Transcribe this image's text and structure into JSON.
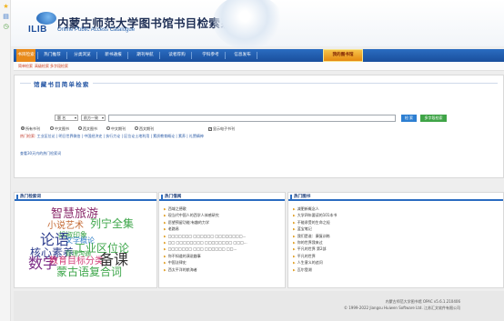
{
  "leftbar": {
    "icons": [
      "star-icon",
      "bookmark-icon",
      "history-icon"
    ],
    "colors": {
      "star": "#f1b41d",
      "bookmark": "#3c78c8",
      "history": "#4a9a3a"
    }
  },
  "header": {
    "logo_text": "ILIB",
    "title": "内蒙古师范大学图书馆书目检索系统",
    "subtitle": "Online Public Access Catalogue"
  },
  "nav": {
    "tabs": [
      {
        "label": "书目检索",
        "active": true
      },
      {
        "label": "热门推荐"
      },
      {
        "label": "分类浏览"
      },
      {
        "label": "新书通报"
      },
      {
        "label": "期刊导航"
      },
      {
        "label": "读者荐购"
      },
      {
        "label": "学科参考"
      },
      {
        "label": "信息发布"
      },
      {
        "label": "我的图书馆",
        "highlighted": true
      }
    ]
  },
  "subnav": {
    "items": [
      "简单检索",
      "高级检索",
      "多字段检索"
    ]
  },
  "search": {
    "panel_title": "馆藏书目简单检索",
    "field_select": "题 名",
    "match_select": "前方一致",
    "query_value": "",
    "search_button": "检 索",
    "advanced_button": "多字段检索",
    "doc_types": [
      {
        "label": "所有书刊",
        "checked": true
      },
      {
        "label": "中文图书"
      },
      {
        "label": "西文图书"
      },
      {
        "label": "中文期刊"
      },
      {
        "label": "西文期刊"
      }
    ],
    "ebook_checkbox": {
      "label": "显示电子书刊",
      "checked": true
    },
    "hotwords_label": "热门检索:",
    "hotwords": "工业区位论 | 明日世界微伯 | 中国经济史 | 执行力论 | 区位论土地利用 | 素质教育概论 | 素养 | 礼赞精神",
    "recent_link": "查看30天内的热门检索词"
  },
  "hot_search": {
    "title": "热门检索词",
    "words": [
      {
        "text": "智慧旅游",
        "color": "#8a2a6b"
      },
      {
        "text": "小说艺术",
        "color": "#c46a34"
      },
      {
        "text": "列宁全集",
        "color": "#3da64a"
      },
      {
        "text": "胡椒印象",
        "color": "#3da64a"
      },
      {
        "text": "论语",
        "color": "#2f3f8f"
      },
      {
        "text": "文学概论",
        "color": "#2f7fc7"
      },
      {
        "text": "工业区位论",
        "color": "#3da64a"
      },
      {
        "text": "核心素养",
        "color": "#2f3f8f"
      },
      {
        "text": "管理沟通",
        "color": "#3da64a"
      },
      {
        "text": "数学",
        "color": "#7a2a85"
      },
      {
        "text": "教育目标分类",
        "color": "#d4407a"
      },
      {
        "text": "备课",
        "color": "#333333"
      },
      {
        "text": "蒙古语复合词",
        "color": "#3da64a"
      }
    ]
  },
  "hot_borrow": {
    "title": "热门借阅",
    "items": [
      "西域之德歌",
      "现当代中国人的西学人体感研究",
      "愿望预留功能:有趣的力学",
      "老路易",
      "□□□□□□□ □□□□□□ □□□□□□□□...",
      "□□ □□□□□□□□ □□□□□□□□ □□□...",
      "□□□□□□□ □□□ □□□□□□ □□...",
      "你不知道的演说趣事",
      "中国法律史",
      "西太平洋的航海者"
    ]
  },
  "hot_books": {
    "title": "热门图书",
    "items": [
      "减肥新概念人",
      "大学四年要读的101本书",
      "不能承受的生命之轻",
      "蓝宝笔记",
      "我们是谁：康复训练",
      "你的世界我来过",
      "平凡的世界 第2部",
      "平凡的世界",
      "人生意义的追问",
      "瓦尔登湖"
    ]
  },
  "footer": {
    "line1": "内蒙古师范大学图书馆  OPAC v5.6.1.210406",
    "line2": "© 1999-2022 Jiangsu Huiwen Software Ltd. 江苏汇文软件有限公司"
  }
}
